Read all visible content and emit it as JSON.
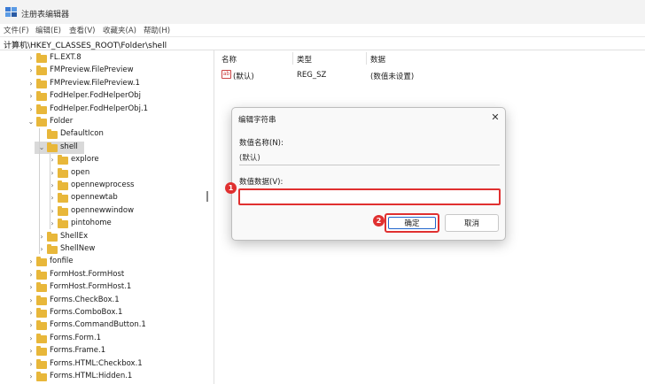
{
  "window": {
    "title": "注册表编辑器"
  },
  "menu": {
    "items": [
      "文件(F)",
      "编辑(E)",
      "查看(V)",
      "收藏夹(A)",
      "帮助(H)"
    ]
  },
  "address": {
    "path": "计算机\\HKEY_CLASSES_ROOT\\Folder\\shell"
  },
  "tree": {
    "items": [
      {
        "label": "FL.EXT.8",
        "level": 0,
        "expanded": false
      },
      {
        "label": "FMPreview.FilePreview",
        "level": 0,
        "expanded": false
      },
      {
        "label": "FMPreview.FilePreview.1",
        "level": 0,
        "expanded": false
      },
      {
        "label": "FodHelper.FodHelperObj",
        "level": 0,
        "expanded": false
      },
      {
        "label": "FodHelper.FodHelperObj.1",
        "level": 0,
        "expanded": false
      },
      {
        "label": "Folder",
        "level": 0,
        "expanded": true
      },
      {
        "label": "DefaultIcon",
        "level": 1,
        "expanded": null
      },
      {
        "label": "shell",
        "level": 1,
        "expanded": true,
        "selected": true
      },
      {
        "label": "explore",
        "level": 2,
        "expanded": false
      },
      {
        "label": "open",
        "level": 2,
        "expanded": false
      },
      {
        "label": "opennewprocess",
        "level": 2,
        "expanded": false
      },
      {
        "label": "opennewtab",
        "level": 2,
        "expanded": false
      },
      {
        "label": "opennewwindow",
        "level": 2,
        "expanded": false
      },
      {
        "label": "pintohome",
        "level": 2,
        "expanded": false
      },
      {
        "label": "ShellEx",
        "level": 1,
        "expanded": false
      },
      {
        "label": "ShellNew",
        "level": 1,
        "expanded": false
      },
      {
        "label": "fonfile",
        "level": 0,
        "expanded": false
      },
      {
        "label": "FormHost.FormHost",
        "level": 0,
        "expanded": false
      },
      {
        "label": "FormHost.FormHost.1",
        "level": 0,
        "expanded": false
      },
      {
        "label": "Forms.CheckBox.1",
        "level": 0,
        "expanded": false
      },
      {
        "label": "Forms.ComboBox.1",
        "level": 0,
        "expanded": false
      },
      {
        "label": "Forms.CommandButton.1",
        "level": 0,
        "expanded": false
      },
      {
        "label": "Forms.Form.1",
        "level": 0,
        "expanded": false
      },
      {
        "label": "Forms.Frame.1",
        "level": 0,
        "expanded": false
      },
      {
        "label": "Forms.HTML:Checkbox.1",
        "level": 0,
        "expanded": false
      },
      {
        "label": "Forms.HTML:Hidden.1",
        "level": 0,
        "expanded": false
      }
    ]
  },
  "values": {
    "columns": [
      "名称",
      "类型",
      "数据"
    ],
    "rows": [
      {
        "icon": "ab-string-icon",
        "icon_text": "ab",
        "name": "(默认)",
        "type": "REG_SZ",
        "data": "(数值未设置)"
      }
    ]
  },
  "dialog": {
    "title": "编辑字符串",
    "name_label": "数值名称(N):",
    "name_value": "(默认)",
    "data_label": "数值数据(V):",
    "data_value": "",
    "ok_label": "确定",
    "cancel_label": "取消",
    "close_icon": "close-icon",
    "close_glyph": "✕"
  },
  "annotations": {
    "step1": "1",
    "step2": "2",
    "color": "#e03030"
  },
  "colors": {
    "folder": "#e8b73a",
    "highlight": "#e03030",
    "focus": "#2266cc"
  }
}
